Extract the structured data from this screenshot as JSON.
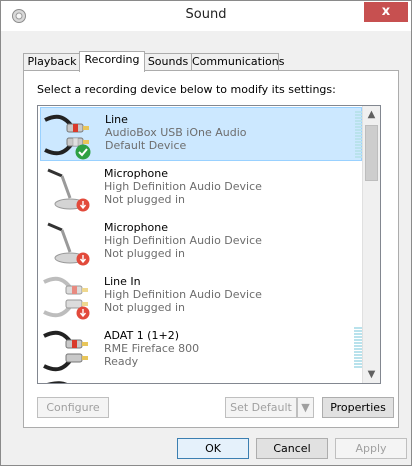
{
  "window": {
    "title": "Sound",
    "close_label": "x"
  },
  "tabs": [
    {
      "label": "Playback",
      "active": false
    },
    {
      "label": "Recording",
      "active": true
    },
    {
      "label": "Sounds",
      "active": false
    },
    {
      "label": "Communications",
      "active": false
    }
  ],
  "panel": {
    "instruction": "Select a recording device below to modify its settings:"
  },
  "devices": [
    {
      "name": "Line",
      "sub1": "AudioBox USB iOne Audio",
      "sub2": "Default Device",
      "icon": "rca-cable-icon",
      "status": "default-check",
      "selected": true,
      "meter": true
    },
    {
      "name": "Microphone",
      "sub1": "High Definition Audio Device",
      "sub2": "Not plugged in",
      "icon": "microphone-icon",
      "status": "unplugged",
      "selected": false,
      "meter": false
    },
    {
      "name": "Microphone",
      "sub1": "High Definition Audio Device",
      "sub2": "Not plugged in",
      "icon": "microphone-icon",
      "status": "unplugged",
      "selected": false,
      "meter": false
    },
    {
      "name": "Line In",
      "sub1": "High Definition Audio Device",
      "sub2": "Not plugged in",
      "icon": "rca-cable-icon",
      "status": "unplugged",
      "selected": false,
      "meter": false
    },
    {
      "name": "ADAT 1 (1+2)",
      "sub1": "RME Fireface 800",
      "sub2": "Ready",
      "icon": "rca-cable-icon",
      "status": "none",
      "selected": false,
      "meter": true
    }
  ],
  "buttons": {
    "configure": "Configure",
    "set_default": "Set Default",
    "properties": "Properties",
    "ok": "OK",
    "cancel": "Cancel",
    "apply": "Apply"
  },
  "colors": {
    "selection": "#cce8ff",
    "close": "#c75050",
    "meter": "#b9e2ec"
  }
}
